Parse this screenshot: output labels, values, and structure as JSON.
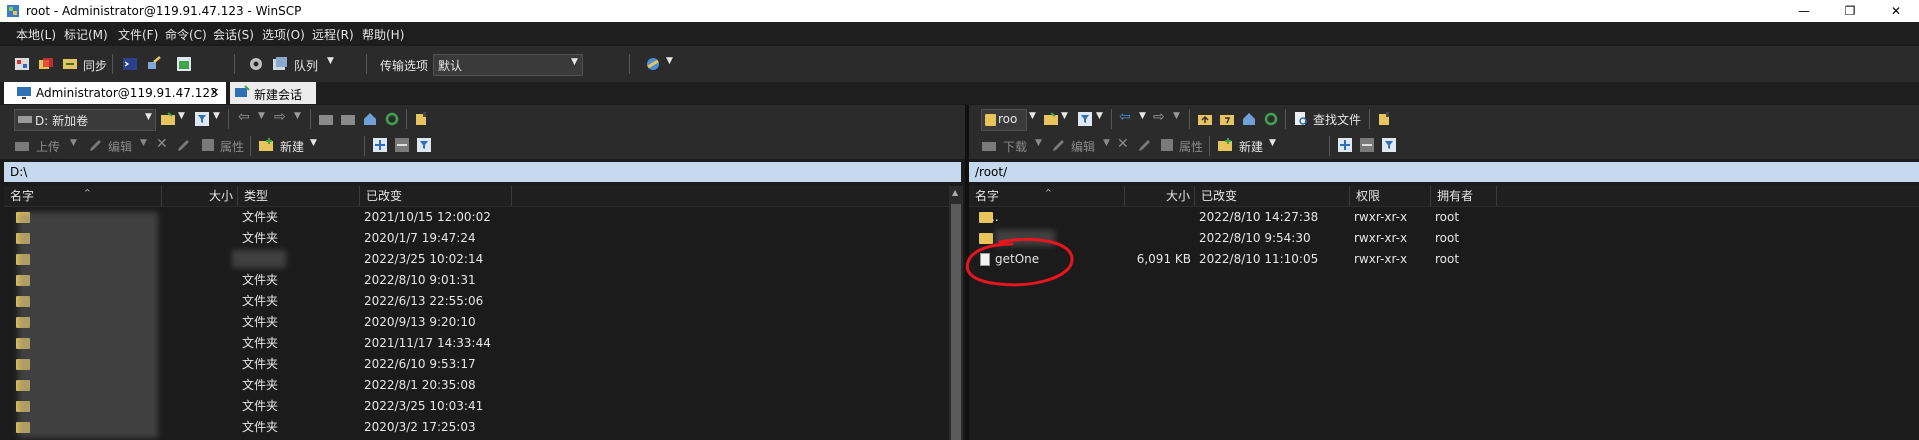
{
  "window": {
    "title": "root - Administrator@119.91.47.123 - WinSCP",
    "controls": [
      "—",
      "❐",
      "✕"
    ]
  },
  "menu": [
    "本地(L)",
    "标记(M)",
    "文件(F)",
    "命令(C)",
    "会话(S)",
    "选项(O)",
    "远程(R)",
    "帮助(H)"
  ],
  "toolbar": {
    "sync_label": "同步",
    "queue_label": "队列",
    "transfer_options_label": "传输选项",
    "transfer_options_value": "默认"
  },
  "tabs": {
    "active": "Administrator@119.91.47.123",
    "close_glyph": "✕",
    "new_session": "新建会话"
  },
  "left_panel": {
    "drive": "D: 新加卷",
    "upload": "上传",
    "edit": "编辑",
    "properties": "属性",
    "new": "新建",
    "path": "D:\\",
    "columns": [
      "名字",
      "大小",
      "类型",
      "已改变"
    ],
    "rows": [
      {
        "type": "文件夹",
        "modified": "2021/10/15  12:00:02"
      },
      {
        "type": "文件夹",
        "modified": "2020/1/7  19:47:24"
      },
      {
        "type": "",
        "modified": "2022/3/25  10:02:14"
      },
      {
        "type": "文件夹",
        "modified": "2022/8/10  9:01:31"
      },
      {
        "type": "文件夹",
        "modified": "2022/6/13  22:55:06"
      },
      {
        "type": "文件夹",
        "modified": "2020/9/13  9:20:10"
      },
      {
        "type": "文件夹",
        "modified": "2021/11/17  14:33:44"
      },
      {
        "type": "文件夹",
        "modified": "2022/6/10  9:53:17"
      },
      {
        "type": "文件夹",
        "modified": "2022/8/1  20:35:08"
      },
      {
        "type": "文件夹",
        "modified": "2022/3/25  10:03:41"
      },
      {
        "type": "文件夹",
        "modified": "2020/3/2  17:25:03"
      }
    ]
  },
  "right_panel": {
    "dir_combo": "roo",
    "find_files": "查找文件",
    "download": "下载",
    "edit": "编辑",
    "properties": "属性",
    "new": "新建",
    "path": "/root/",
    "columns": [
      "名字",
      "大小",
      "已改变",
      "权限",
      "拥有者"
    ],
    "rows": [
      {
        "name": "..",
        "size": "",
        "modified": "2022/8/10 14:27:38",
        "rights": "rwxr-xr-x",
        "owner": "root"
      },
      {
        "name": "",
        "size": "",
        "modified": "2022/8/10 9:54:30",
        "rights": "rwxr-xr-x",
        "owner": "root"
      },
      {
        "name": "getOne",
        "size": "6,091 KB",
        "modified": "2022/8/10 11:10:05",
        "rights": "rwxr-xr-x",
        "owner": "root"
      }
    ]
  },
  "colors": {
    "annotation": "#e8141e",
    "path_bar": "#c5d9ee",
    "folder": "#e8c45c"
  }
}
